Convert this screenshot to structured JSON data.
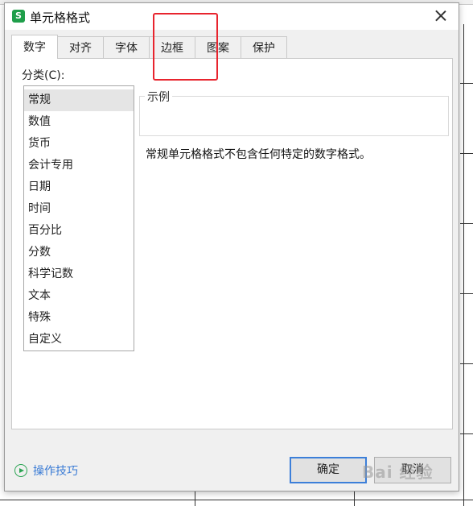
{
  "window": {
    "title": "单元格格式",
    "app_icon_letter": "S"
  },
  "tabs": [
    {
      "label": "数字",
      "active": true
    },
    {
      "label": "对齐",
      "active": false
    },
    {
      "label": "字体",
      "active": false
    },
    {
      "label": "边框",
      "active": false
    },
    {
      "label": "图案",
      "active": false
    },
    {
      "label": "保护",
      "active": false
    }
  ],
  "category": {
    "label": "分类(C):",
    "selected": "常规",
    "items": [
      "常规",
      "数值",
      "货币",
      "会计专用",
      "日期",
      "时间",
      "百分比",
      "分数",
      "科学记数",
      "文本",
      "特殊",
      "自定义"
    ]
  },
  "sample": {
    "legend": "示例"
  },
  "description": "常规单元格格式不包含任何特定的数字格式。",
  "footer": {
    "tips_label": "操作技巧",
    "ok_label": "确定",
    "cancel_label": "取消"
  },
  "watermark": "Bai 经验",
  "colors": {
    "highlight": "#e8242e",
    "tips_link": "#3a7bd5",
    "app_icon": "#1f9e4a",
    "default_button_border": "#3c7fd9"
  }
}
